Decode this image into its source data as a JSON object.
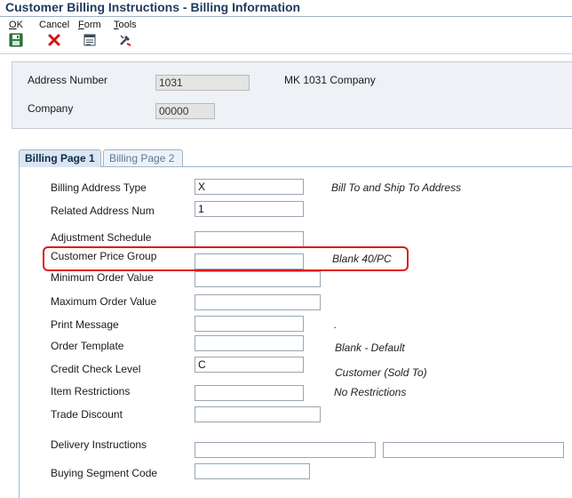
{
  "window": {
    "title": "Customer Billing Instructions - Billing Information"
  },
  "toolbar": {
    "ok": {
      "mnemonic": "O",
      "rest": "K",
      "icon": "save-icon"
    },
    "cancel": {
      "label": "Cancel",
      "icon": "cancel-x-icon"
    },
    "form": {
      "mnemonic": "F",
      "rest": "orm",
      "icon": "form-icon"
    },
    "tools": {
      "mnemonic": "T",
      "rest": "ools",
      "icon": "tools-icon"
    }
  },
  "header": {
    "address_number_label": "Address Number",
    "address_number_value": "1031",
    "company_name": "MK 1031 Company",
    "company_label": "Company",
    "company_value": "00000"
  },
  "tabs": [
    {
      "label": "Billing Page 1",
      "active": true
    },
    {
      "label": "Billing Page 2",
      "active": false
    }
  ],
  "form": {
    "billing_address_type": {
      "label": "Billing Address Type",
      "value": "X",
      "desc": "Bill To and Ship To Address"
    },
    "related_address_num": {
      "label": "Related Address Num",
      "value": "1"
    },
    "adjustment_schedule": {
      "label": "Adjustment Schedule",
      "value": ""
    },
    "customer_price_group": {
      "label": "Customer Price Group",
      "value": "",
      "desc": "Blank 40/PC"
    },
    "minimum_order_value": {
      "label": "Minimum Order Value",
      "value": ""
    },
    "maximum_order_value": {
      "label": "Maximum Order Value",
      "value": ""
    },
    "print_message": {
      "label": "Print Message",
      "value": "",
      "desc": "."
    },
    "order_template": {
      "label": "Order Template",
      "value": "",
      "desc": "Blank - Default"
    },
    "credit_check_level": {
      "label": "Credit Check Level",
      "value": "C",
      "desc": "Customer (Sold To)"
    },
    "item_restrictions": {
      "label": "Item Restrictions",
      "value": "",
      "desc": "No Restrictions"
    },
    "trade_discount": {
      "label": "Trade Discount",
      "value": ""
    },
    "delivery_instructions": {
      "label": "Delivery Instructions",
      "value1": "",
      "value2": ""
    },
    "buying_segment_code": {
      "label": "Buying Segment Code",
      "value": ""
    }
  },
  "colors": {
    "highlight": "#e0161c",
    "title": "#1f3a5f",
    "tab_active": "#d9e6f2"
  }
}
